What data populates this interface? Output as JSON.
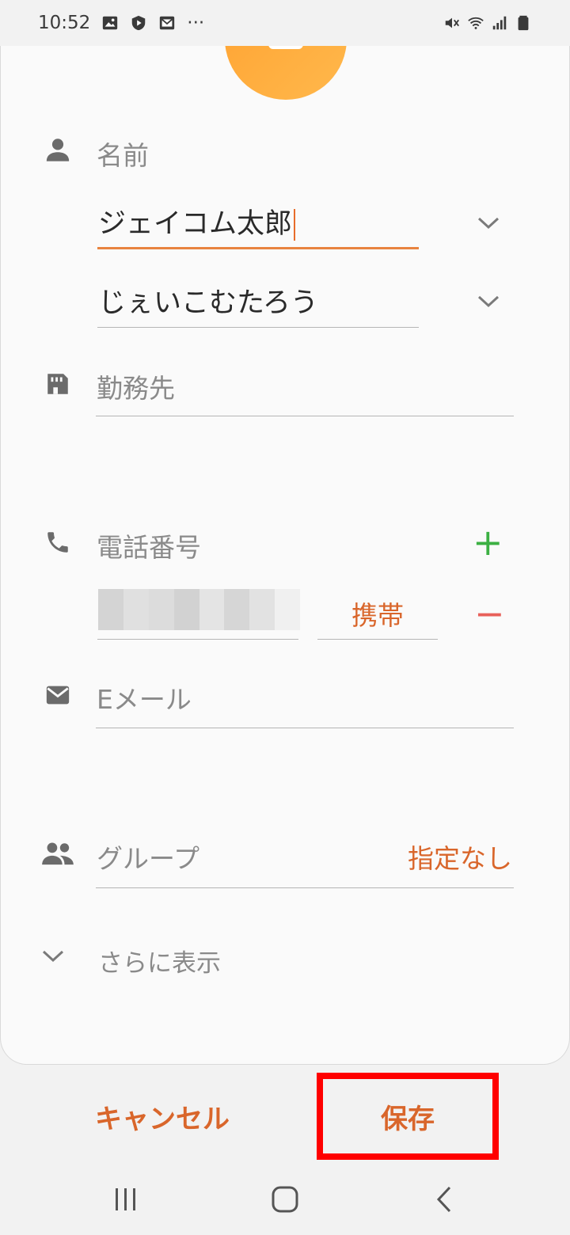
{
  "status_bar": {
    "time": "10:52",
    "more": "···",
    "icons_left": [
      "image-icon",
      "shield-icon",
      "mail-icon"
    ],
    "icons_right": [
      "mute-icon",
      "wifi-icon",
      "signal-icon",
      "battery-icon"
    ]
  },
  "form": {
    "name": {
      "label": "名前",
      "value": "ジェイコム太郎",
      "phonetic": "じぇいこむたろう"
    },
    "company": {
      "label": "勤務先"
    },
    "phone": {
      "label": "電話番号",
      "type": "携帯",
      "add": "+",
      "remove": "−"
    },
    "email": {
      "label": "Eメール"
    },
    "group": {
      "label": "グループ",
      "value": "指定なし"
    },
    "more": {
      "label": "さらに表示"
    }
  },
  "actions": {
    "cancel": "キャンセル",
    "save": "保存"
  },
  "colors": {
    "accent": "#d9662b",
    "add": "#3cb043",
    "remove": "#e8605a",
    "highlight": "#ff0000",
    "avatar": "#ffa030"
  }
}
